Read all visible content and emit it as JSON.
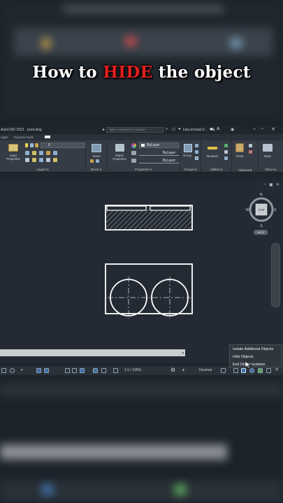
{
  "caption": {
    "prefix": "How to ",
    "highlight": "HIDE",
    "suffix": " the object"
  },
  "titlebar": {
    "app_name": "AutoCAD 2023",
    "file_name": "pred.dwg",
    "search_placeholder": "Type a keyword or phrase",
    "user": "luka.tomasic2..."
  },
  "tabs": [
    "Apps",
    "Express Tools"
  ],
  "ribbon": {
    "panels": [
      "Layers",
      "Block",
      "Properties",
      "Groups",
      "Utilities",
      "Clipboard",
      "View"
    ],
    "tools": {
      "layer_properties": "Layer Properties",
      "layer_value": "0",
      "insert": "Insert",
      "match_properties": "Match Properties",
      "bylayer_1": "ByLayer",
      "bylayer_2": "ByLayer",
      "bylayer_3": "ByLayer",
      "group": "Group",
      "measure": "Measure",
      "paste": "Paste",
      "base": "Base"
    }
  },
  "viewcube": {
    "top": "TOP",
    "n": "N",
    "s": "S",
    "w": "W",
    "e": "E",
    "wcs": "WCS"
  },
  "statusbar": {
    "scale": "1:1 / 100%",
    "units": "Decimal"
  },
  "popup_menu": {
    "items": [
      "Isolate Additional Objects",
      "Hide Objects",
      "End Object Isolation"
    ]
  },
  "colors": {
    "highlight": "#e41f1f",
    "canvas": "#242a33",
    "ribbon": "#353c45"
  }
}
